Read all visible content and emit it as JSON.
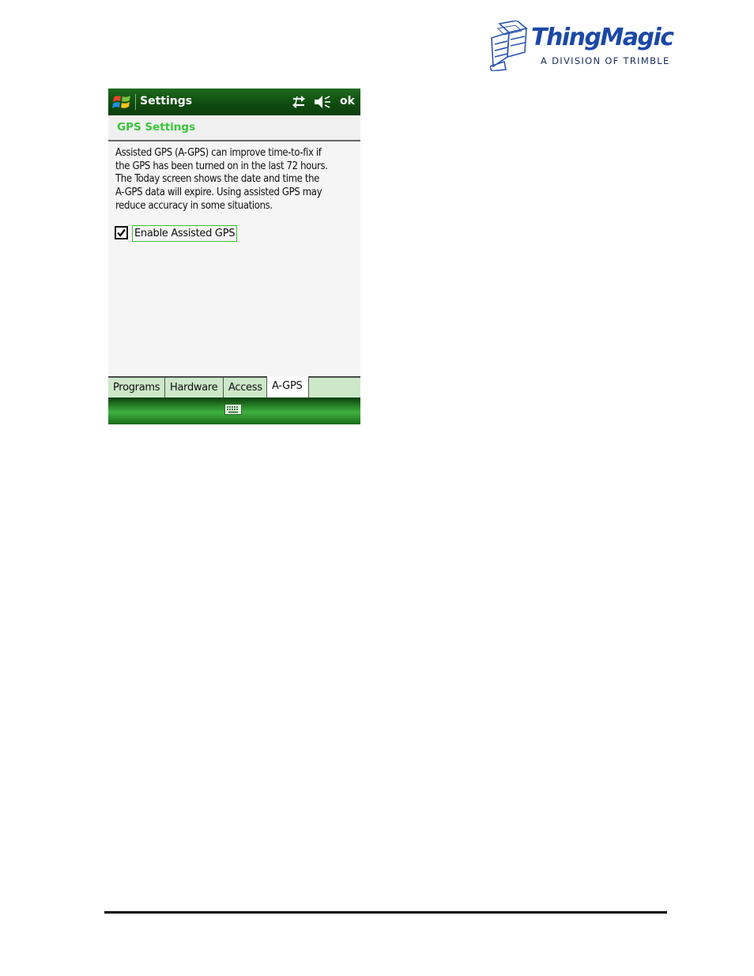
{
  "logo": {
    "brand": "ThingMagic",
    "tagline": "A DIVISION OF TRIMBLE"
  },
  "titlebar": {
    "title": "Settings",
    "ok_label": "ok"
  },
  "header": {
    "title": "GPS Settings"
  },
  "content": {
    "description": "Assisted GPS (A-GPS) can improve time-to-fix if\nthe GPS has been turned on in the last 72 hours.\nThe Today screen shows the date and time the\nA-GPS data will expire.  Using assisted GPS may\nreduce accuracy in some situations.",
    "checkbox": {
      "label": "Enable Assisted GPS",
      "checked": true
    }
  },
  "tabs": [
    {
      "label": "Programs",
      "active": false
    },
    {
      "label": "Hardware",
      "active": false
    },
    {
      "label": "Access",
      "active": false
    },
    {
      "label": "A-GPS",
      "active": true
    }
  ],
  "icons": {
    "start": "windows-flag-icon",
    "connectivity": "connectivity-icon",
    "volume": "speaker-muted-icon",
    "input": "keyboard-icon"
  },
  "colors": {
    "titlebar": "#0f4a10",
    "accent_green": "#39c539",
    "tab_background": "#cce8c8",
    "logo_blue": "#1b48a8"
  }
}
